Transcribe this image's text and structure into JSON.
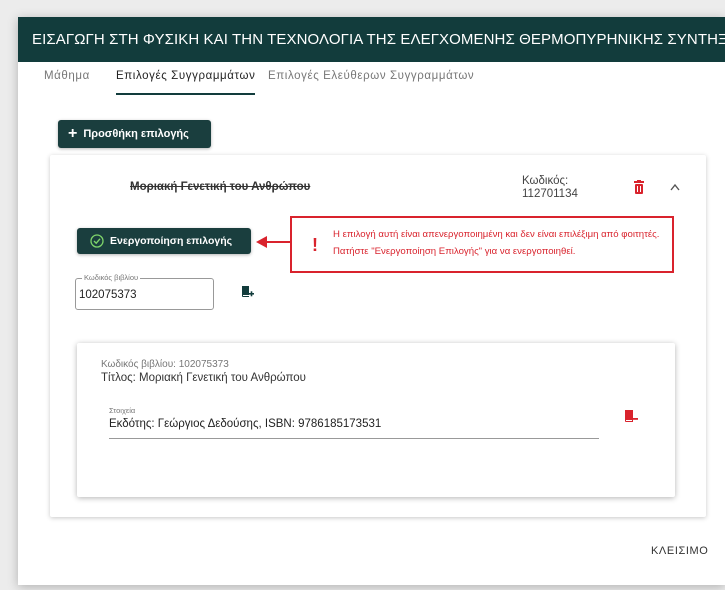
{
  "dialog": {
    "title": "ΕΙΣΑΓΩΓΗ ΣΤΗ ΦΥΣΙΚΗ ΚΑΙ ΤΗΝ ΤΕΧΝΟΛΟΓΙΑ ΤΗΣ ΕΛΕΓΧΟΜΕΝΗΣ ΘΕΡΜΟΠΥΡΗΝΙΚΗΣ ΣΥΝΤΗΞΗΣ",
    "close_label": "ΚΛΕΙΣΙΜΟ"
  },
  "tabs": [
    {
      "label": "Μάθημα",
      "active": false
    },
    {
      "label": "Επιλογές Συγγραμμάτων",
      "active": true
    },
    {
      "label": "Επιλογές Ελεύθερων Συγγραμμάτων",
      "active": false
    }
  ],
  "add_option_label": "Προσθήκη επιλογής",
  "option": {
    "title": "Μοριακή Γενετική του Ανθρώπου",
    "code_label": "Κωδικός:",
    "code_value": "112701134",
    "activate_label": "Ενεργοποίηση επιλογής",
    "warning_text": "Η επιλογή αυτή είναι απενεργοποιημένη και δεν είναι επιλέξιμη από φοιτητές. Πατήστε \"Ενεργοποίηση Επιλογής\" για να ενεργοποιηθεί.",
    "warning_symbol": "!",
    "book_code_field": {
      "label": "Κωδικός βιβλίου",
      "value": "102075373"
    },
    "book": {
      "code_line": "Κωδικός βιβλίου: 102075373",
      "title_line": "Τίτλος: Μοριακή Γενετική του Ανθρώπου",
      "details_label": "Στοιχεία",
      "details_value": "Εκδότης: Γεώργιος Δεδούσης, ISBN: 9786185173531"
    }
  },
  "colors": {
    "header": "#123c3c",
    "primary_button": "#1a3e3e",
    "danger": "#d9232d"
  },
  "icons": [
    "plus-icon",
    "delete-icon",
    "chevron-up-icon",
    "check-circle-icon",
    "arrow-left-icon",
    "add-book-icon",
    "remove-book-icon"
  ]
}
